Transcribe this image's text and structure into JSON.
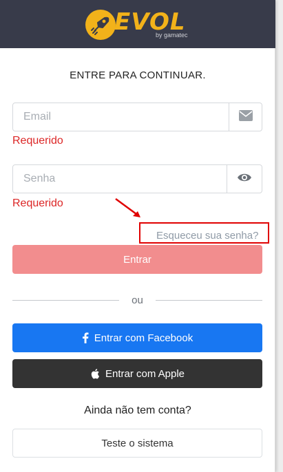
{
  "brand": {
    "name": "EVOL",
    "sub": "by gamatec",
    "header_color": "#383b4a",
    "logo_color": "#f2b21a"
  },
  "login": {
    "title": "ENTRE PARA CONTINUAR.",
    "email_placeholder": "Email",
    "email_value": "",
    "email_error": "Requerido",
    "password_placeholder": "Senha",
    "password_value": "",
    "password_error": "Requerido",
    "forgot_label": "Esqueceu sua senha?",
    "submit_label": "Entrar",
    "divider_label": "ou",
    "facebook_label": "Entrar com Facebook",
    "apple_label": "Entrar com Apple",
    "no_account_label": "Ainda não tem conta?",
    "trial_label": "Teste o sistema"
  },
  "icons": {
    "email": "envelope-icon",
    "password": "eye-icon",
    "facebook": "facebook-icon",
    "apple": "apple-icon"
  },
  "colors": {
    "error": "#dc2626",
    "primary": "#f28d8e",
    "facebook": "#1877f2",
    "apple": "#333333",
    "annotation": "#e00000"
  }
}
